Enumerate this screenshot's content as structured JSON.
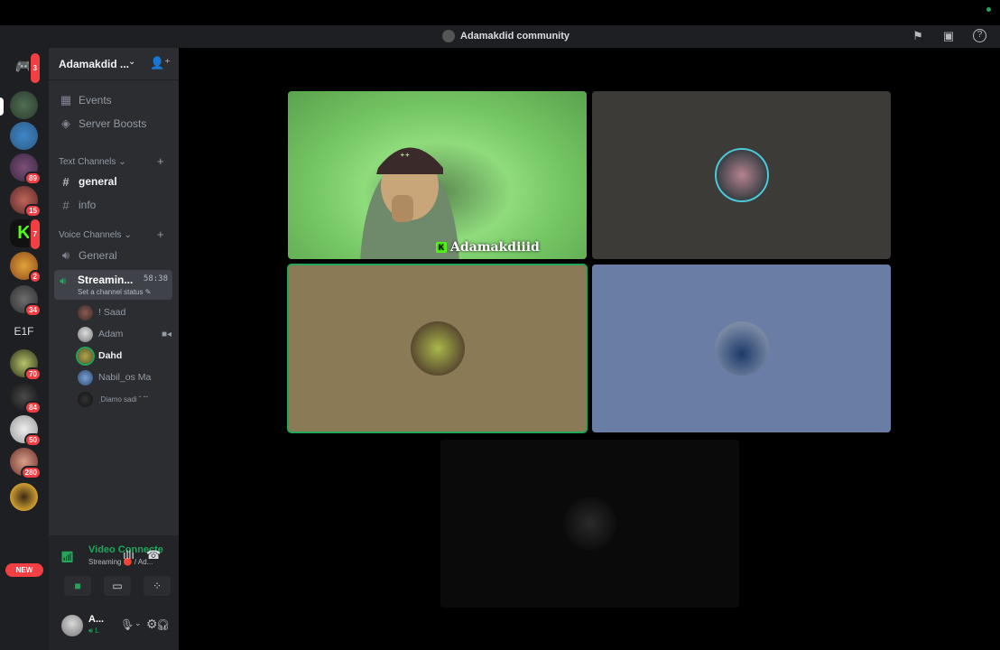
{
  "window": {
    "title": "Adamakdid community"
  },
  "rail": {
    "home_badge": "3",
    "badges": [
      "89",
      "15",
      "7",
      "2",
      "34",
      "70",
      "84",
      "50",
      "280"
    ],
    "text_server": "E1F",
    "new_label": "NEW",
    "new_sub_badge": "1"
  },
  "sidebar": {
    "server_name": "Adamakdid ...",
    "events_label": "Events",
    "boosts_label": "Server Boosts",
    "text_category": "Text Channels",
    "text_channels": [
      "general",
      "info"
    ],
    "voice_category": "Voice Channels",
    "voice_channel_general": "General",
    "active_channel": {
      "name": "Streamin...",
      "timer": "58:38",
      "status_prompt": "Set a channel status"
    },
    "members": [
      "! Saad",
      "Adam",
      "Dahd",
      "Nabil_os Ma",
      "ˌDiamo sadi ˆ ˆˆ"
    ]
  },
  "voice_panel": {
    "status": "Video Connecte",
    "sub": "Streaming 🔴 / Ad..."
  },
  "user_panel": {
    "name": "A...",
    "status": "L"
  },
  "stage": {
    "streamer_name": "Adamakdiiid"
  },
  "colors": {
    "accent_green": "#23a55a",
    "tile_dark": "#3d3b37",
    "tile_olive": "#8a7a55",
    "tile_blue": "#6a7ea5",
    "badge_red": "#f23f43"
  }
}
